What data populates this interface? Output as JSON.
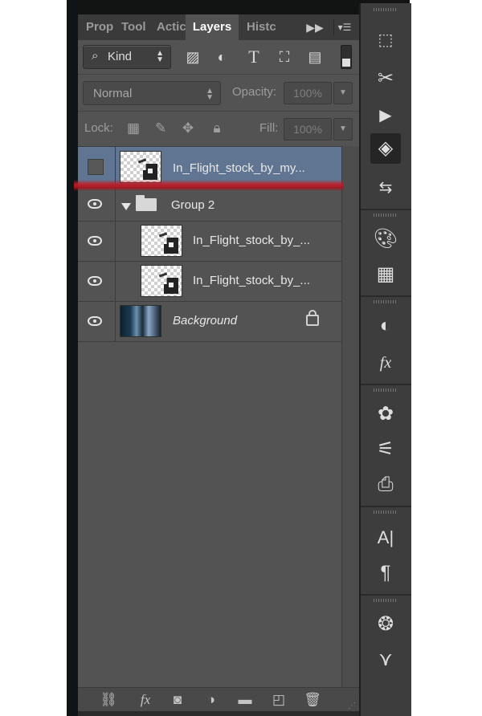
{
  "tabs": [
    {
      "label": "Prop",
      "active": false
    },
    {
      "label": "Tool",
      "active": false
    },
    {
      "label": "Actic",
      "active": false
    },
    {
      "label": "Layers",
      "active": true
    },
    {
      "label": "Histc",
      "active": false
    }
  ],
  "tab_overflow_icon": "double-chevron-right",
  "tab_menu_icon": "panel-menu-icon",
  "filter": {
    "kind_label": "Kind",
    "filter_icons": [
      "image-filter-icon",
      "adjustment-filter-icon",
      "type-filter-icon",
      "shape-filter-icon",
      "smart-object-filter-icon"
    ]
  },
  "blend": {
    "mode": "Normal",
    "opacity_label": "Opacity:",
    "opacity_value": "100%"
  },
  "lock": {
    "label": "Lock:",
    "icons": [
      "lock-transparent-icon",
      "lock-paint-icon",
      "lock-position-icon",
      "lock-all-icon"
    ],
    "fill_label": "Fill:",
    "fill_value": "100%"
  },
  "layers": [
    {
      "name": "In_Flight_stock_by_my...",
      "visible": false,
      "selected": true,
      "type": "smart"
    },
    {
      "name": "Group 2",
      "visible": true,
      "selected": false,
      "type": "group"
    },
    {
      "name": "In_Flight_stock_by_...",
      "visible": true,
      "selected": false,
      "type": "smart",
      "indent": true
    },
    {
      "name": "In_Flight_stock_by_...",
      "visible": true,
      "selected": false,
      "type": "smart",
      "indent": true
    },
    {
      "name": "Background",
      "visible": true,
      "selected": false,
      "type": "background",
      "locked": true
    }
  ],
  "bottom_icons": [
    "link-layers-icon",
    "fx-icon",
    "layer-mask-icon",
    "adjustment-layer-icon",
    "new-group-icon",
    "new-layer-icon",
    "delete-layer-icon"
  ],
  "dock_icons": [
    "3d-icon",
    "tools-icon",
    "play-icon",
    "layers-icon",
    "history-icon",
    "swatches-icon",
    "grid-icon",
    "color-icon",
    "fx-icon",
    "brush-icon",
    "brush-presets-icon",
    "clone-source-icon",
    "character-icon",
    "paragraph-icon",
    "channels-icon",
    "paths-icon"
  ]
}
